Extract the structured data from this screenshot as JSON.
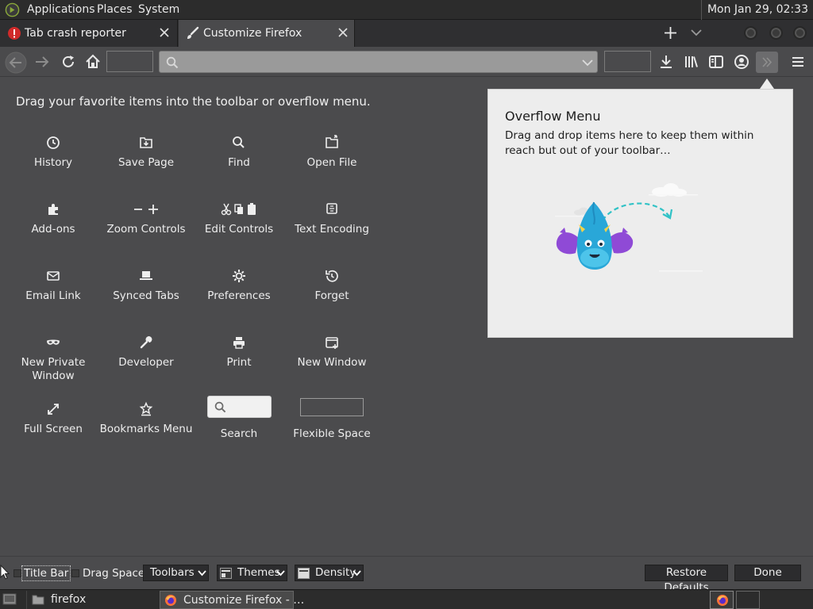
{
  "top_panel": {
    "menus": [
      "Applications",
      "Places",
      "System"
    ],
    "clock": "Mon Jan 29, 02:33"
  },
  "tabs": [
    {
      "label": "Tab crash reporter",
      "icon": "crash-warning-icon",
      "active": false
    },
    {
      "label": "Customize Firefox",
      "icon": "paintbrush-icon",
      "active": true
    }
  ],
  "instructions": "Drag your favorite items into the toolbar or overflow menu.",
  "palette": [
    {
      "label": "History",
      "icon": "clock-icon"
    },
    {
      "label": "Save Page",
      "icon": "save-page-icon"
    },
    {
      "label": "Find",
      "icon": "magnifier-icon"
    },
    {
      "label": "Open File",
      "icon": "open-file-icon"
    },
    {
      "label": "Add-ons",
      "icon": "puzzle-icon"
    },
    {
      "label": "Zoom Controls",
      "icon": "zoom-icon"
    },
    {
      "label": "Edit Controls",
      "icon": "edit-controls-icon"
    },
    {
      "label": "Text Encoding",
      "icon": "text-encoding-icon"
    },
    {
      "label": "Email Link",
      "icon": "envelope-icon"
    },
    {
      "label": "Synced Tabs",
      "icon": "laptop-icon"
    },
    {
      "label": "Preferences",
      "icon": "gear-icon"
    },
    {
      "label": "Forget",
      "icon": "forget-icon"
    },
    {
      "label": "New Private Window",
      "icon": "mask-icon"
    },
    {
      "label": "Developer",
      "icon": "wrench-icon"
    },
    {
      "label": "Print",
      "icon": "printer-icon"
    },
    {
      "label": "New Window",
      "icon": "new-window-icon"
    },
    {
      "label": "Full Screen",
      "icon": "fullscreen-icon"
    },
    {
      "label": "Bookmarks Menu",
      "icon": "bookmarks-menu-icon"
    },
    {
      "label": "Search",
      "icon": "search-box-icon"
    },
    {
      "label": "Flexible Space",
      "icon": "flexible-space-icon"
    }
  ],
  "overflow": {
    "title": "Overflow Menu",
    "description": "Drag and drop items here to keep them within reach but out of your toolbar…"
  },
  "bottom_bar": {
    "title_bar": "Title Bar",
    "drag_space": "Drag Space",
    "toolbars": "Toolbars",
    "themes": "Themes",
    "density": "Density",
    "restore_defaults": "Restore Defaults",
    "done": "Done"
  },
  "taskbar": {
    "items": [
      "firefox",
      "Customize Firefox - …"
    ]
  },
  "colors": {
    "background": "#4b4b4d",
    "panel": "#2c2c2c",
    "overflow_bg": "#ededed",
    "mascot_blue": "#29a7d8",
    "mascot_purple": "#8f4ad6",
    "arrow_teal": "#30c2c6"
  }
}
